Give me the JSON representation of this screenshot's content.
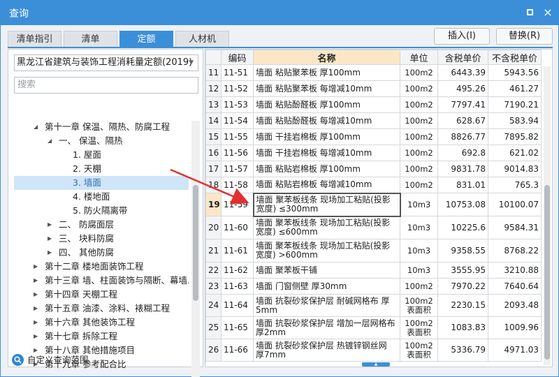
{
  "window": {
    "title": "查询",
    "maximize_icon": "maximize-icon",
    "close_icon": "close-icon",
    "close_glyph": "×"
  },
  "tabs": [
    {
      "label": "清单指引",
      "active": false
    },
    {
      "label": "清单",
      "active": false
    },
    {
      "label": "定额",
      "active": true
    },
    {
      "label": "人材机",
      "active": false
    }
  ],
  "actions": {
    "insert_label": "插入(I)",
    "replace_label": "替换(R)"
  },
  "library": {
    "selected": "黑龙江省建筑与装饰工程消耗量定额(2019)",
    "dropdown_icon": "chevron-down-icon"
  },
  "search": {
    "placeholder": "搜索"
  },
  "tree": [
    {
      "label": "第十一章 保温、隔热、防腐工程",
      "level": 1,
      "expanded": true
    },
    {
      "label": "一、 保温、隔热",
      "level": 2,
      "expanded": true
    },
    {
      "label": "1. 屋面",
      "level": 3
    },
    {
      "label": "2. 天棚",
      "level": 3
    },
    {
      "label": "3. 墙面",
      "level": 3,
      "selected": true
    },
    {
      "label": "4. 楼地面",
      "level": 3
    },
    {
      "label": "5. 防火隔离带",
      "level": 3
    },
    {
      "label": "二、 防腐面层",
      "level": 2,
      "expanded": false
    },
    {
      "label": "三、 块料防腐",
      "level": 2,
      "expanded": false
    },
    {
      "label": "四、 其他防腐",
      "level": 2,
      "expanded": false
    },
    {
      "label": "第十二章 楼地面装饰工程",
      "level": 1,
      "expanded": false
    },
    {
      "label": "第十三章 墙、柱面装饰与隔断、幕墙...",
      "level": 1,
      "expanded": false
    },
    {
      "label": "第十四章 天棚工程",
      "level": 1,
      "expanded": false
    },
    {
      "label": "第十五章 油漆、涂料、裱糊工程",
      "level": 1,
      "expanded": false
    },
    {
      "label": "第十六章 其他装饰工程",
      "level": 1,
      "expanded": false
    },
    {
      "label": "第十七章 拆除工程",
      "level": 1,
      "expanded": false
    },
    {
      "label": "第十八章 其他措施项目",
      "level": 1,
      "expanded": false
    },
    {
      "label": "第十九章 参考配合比",
      "level": 1,
      "expanded": false
    }
  ],
  "custom_range": {
    "label": "自定义查询范围",
    "icon": "search-icon"
  },
  "grid": {
    "columns": [
      "",
      "编码",
      "名称",
      "单位",
      "含税单价",
      "不含税单价"
    ],
    "rows": [
      {
        "no": "11",
        "code": "11-51",
        "name": "墙面 粘贴聚苯板 厚100mm",
        "unit": "100m2",
        "price_tax": "6443.39",
        "price_notax": "5943.56"
      },
      {
        "no": "12",
        "code": "11-52",
        "name": "墙面 粘贴聚苯板 每增减10mm",
        "unit": "100m2",
        "price_tax": "495.26",
        "price_notax": "461.27"
      },
      {
        "no": "13",
        "code": "11-53",
        "name": "墙面 粘贴酚醛板 厚100mm",
        "unit": "100m2",
        "price_tax": "7797.41",
        "price_notax": "7190.21"
      },
      {
        "no": "14",
        "code": "11-54",
        "name": "墙面 粘贴酚醛板 每增减10mm",
        "unit": "100m2",
        "price_tax": "628.67",
        "price_notax": "583.94"
      },
      {
        "no": "15",
        "code": "11-55",
        "name": "墙面 干挂岩棉板 厚100mm",
        "unit": "100m2",
        "price_tax": "8826.77",
        "price_notax": "7895.82"
      },
      {
        "no": "16",
        "code": "11-56",
        "name": "墙面 干挂岩棉板 每增减10mm",
        "unit": "100m2",
        "price_tax": "692.8",
        "price_notax": "621.02"
      },
      {
        "no": "17",
        "code": "11-57",
        "name": "墙面 粘贴岩棉板 厚100mm",
        "unit": "100m2",
        "price_tax": "9831.78",
        "price_notax": "9014.83"
      },
      {
        "no": "18",
        "code": "11-58",
        "name": "墙面 粘贴岩棉板 每增减10mm",
        "unit": "100m2",
        "price_tax": "831.01",
        "price_notax": "765.3"
      },
      {
        "no": "19",
        "code": "11-59",
        "name": "墙面 聚苯板线条 现场加工粘贴(投影宽度) ≤300mm",
        "unit": "10m3",
        "price_tax": "10753.08",
        "price_notax": "10100.07",
        "selected": true
      },
      {
        "no": "20",
        "code": "11-60",
        "name": "墙面 聚苯板线条 现场加工粘贴(投影宽度) ≤600mm",
        "unit": "10m3",
        "price_tax": "10225.6",
        "price_notax": "9584.31"
      },
      {
        "no": "21",
        "code": "11-61",
        "name": "墙面 聚苯板线条 现场加工粘贴(投影宽度) >600mm",
        "unit": "10m3",
        "price_tax": "9358.55",
        "price_notax": "8768.22"
      },
      {
        "no": "22",
        "code": "11-62",
        "name": "墙面 聚苯板干铺",
        "unit": "10m3",
        "price_tax": "3555.95",
        "price_notax": "3210.88"
      },
      {
        "no": "23",
        "code": "11-63",
        "name": "墙面 门窗侧壁 厚30mm",
        "unit": "100m2",
        "price_tax": "7970.22",
        "price_notax": "7640.64"
      },
      {
        "no": "24",
        "code": "11-64",
        "name": "墙面 抗裂砂浆保护层 耐碱网格布 厚5mm",
        "unit": "100m2表面积",
        "price_tax": "2230.15",
        "price_notax": "2093.48"
      },
      {
        "no": "25",
        "code": "11-65",
        "name": "墙面 抗裂砂浆保护层 增加一层网格布 厚2mm",
        "unit": "100m2表面积",
        "price_tax": "1083.83",
        "price_notax": "1009.96"
      },
      {
        "no": "26",
        "code": "11-66",
        "name": "墙面 抗裂砂浆保护层 热镀锌钢丝网 厚7mm",
        "unit": "100m2表面积",
        "price_tax": "5336.79",
        "price_notax": "4971.03"
      }
    ]
  },
  "colors": {
    "accent": "#3b8fd9",
    "header_highlight": "#fbe7c7",
    "selected_tree": "#cfe5f8",
    "annotation_arrow": "#e03030"
  }
}
